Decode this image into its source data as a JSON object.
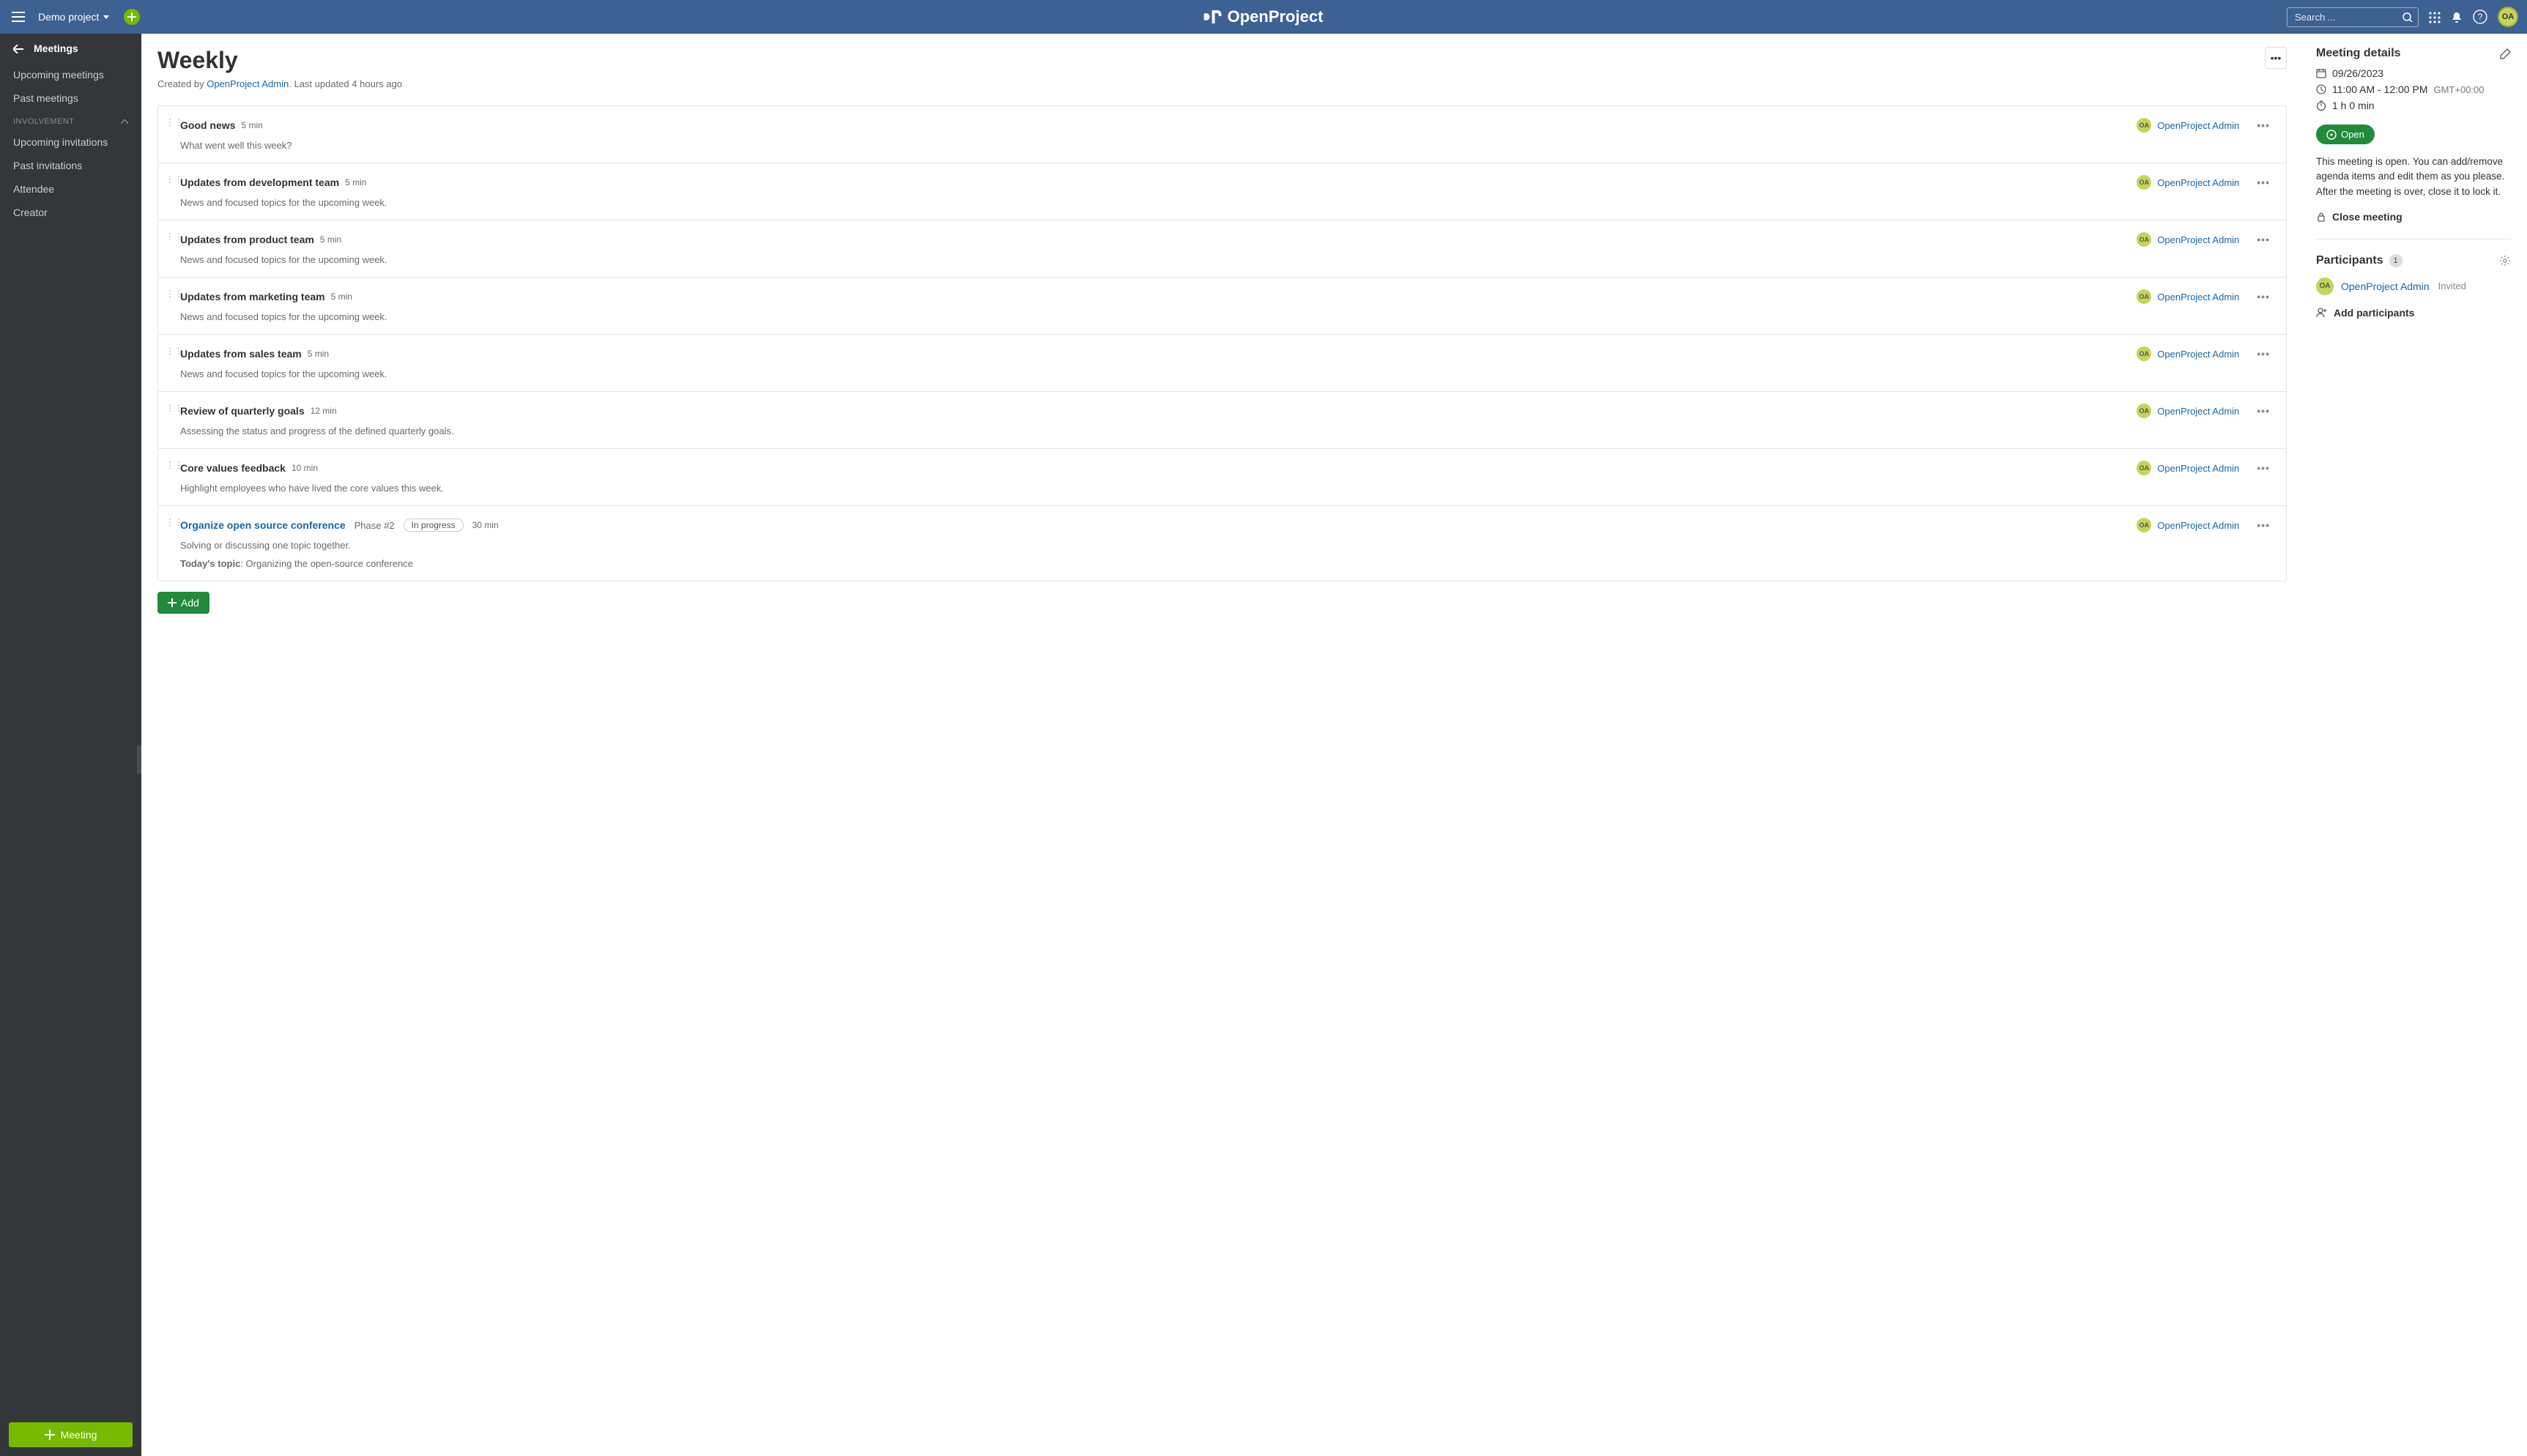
{
  "topbar": {
    "project_name": "Demo project",
    "search_placeholder": "Search ...",
    "brand": "OpenProject",
    "avatar_initials": "OA"
  },
  "sidebar": {
    "module_title": "Meetings",
    "items_top": [
      "Upcoming meetings",
      "Past meetings"
    ],
    "section_label": "INVOLVEMENT",
    "items_inv": [
      "Upcoming invitations",
      "Past invitations",
      "Attendee",
      "Creator"
    ],
    "new_meeting_label": "Meeting"
  },
  "page": {
    "title": "Weekly",
    "created_by_prefix": "Created by",
    "author": "OpenProject Admin",
    "updated_prefix": "Last updated",
    "updated_value": "4 hours ago",
    "add_label": "Add"
  },
  "agenda": [
    {
      "title": "Good news",
      "duration": "5 min",
      "owner": "OpenProject Admin",
      "owner_initials": "OA",
      "desc": "What went well this week?"
    },
    {
      "title": "Updates from development team",
      "duration": "5 min",
      "owner": "OpenProject Admin",
      "owner_initials": "OA",
      "desc": "News and focused topics for the upcoming week."
    },
    {
      "title": "Updates from product team",
      "duration": "5 min",
      "owner": "OpenProject Admin",
      "owner_initials": "OA",
      "desc": "News and focused topics for the upcoming week."
    },
    {
      "title": "Updates from marketing team",
      "duration": "5 min",
      "owner": "OpenProject Admin",
      "owner_initials": "OA",
      "desc": "News and focused topics for the upcoming week."
    },
    {
      "title": "Updates from sales team",
      "duration": "5 min",
      "owner": "OpenProject Admin",
      "owner_initials": "OA",
      "desc": "News and focused topics for the upcoming week."
    },
    {
      "title": "Review of quarterly goals",
      "duration": "12 min",
      "owner": "OpenProject Admin",
      "owner_initials": "OA",
      "desc": "Assessing the status and progress of the defined quarterly goals."
    },
    {
      "title": "Core values feedback",
      "duration": "10 min",
      "owner": "OpenProject Admin",
      "owner_initials": "OA",
      "desc": "Highlight employees who have lived the core values this week."
    },
    {
      "title": "Organize open source conference",
      "duration": "30 min",
      "owner": "OpenProject Admin",
      "owner_initials": "OA",
      "is_link": true,
      "phase": "Phase #2",
      "status": "In progress",
      "desc_line1": "Solving or discussing one topic together.",
      "todays_label": "Today's topic",
      "todays_value": ": Organizing the open-source conference"
    }
  ],
  "details": {
    "heading": "Meeting details",
    "date": "09/26/2023",
    "time": "11:00 AM - 12:00 PM",
    "tz": "GMT+00:00",
    "duration": "1 h 0 min",
    "open_label": "Open",
    "blurb": "This meeting is open. You can add/remove agenda items and edit them as you please. After the meeting is over, close it to lock it.",
    "close_label": "Close meeting",
    "participants_heading": "Participants",
    "participants_count": "1",
    "participant_name": "OpenProject Admin",
    "participant_initials": "OA",
    "invited_label": "Invited",
    "add_participants_label": "Add participants"
  }
}
